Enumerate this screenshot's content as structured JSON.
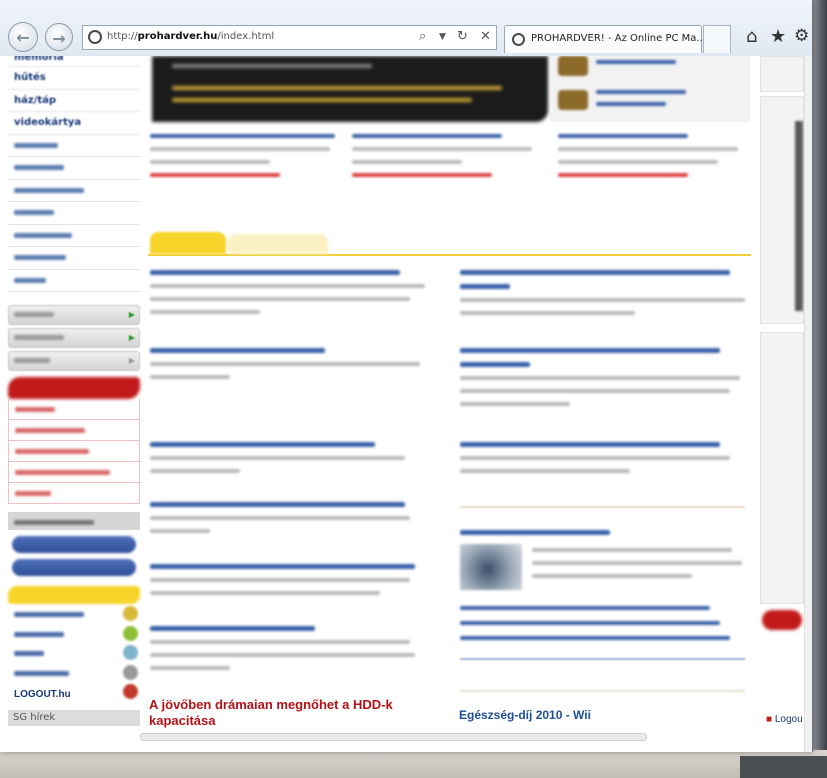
{
  "browser": {
    "url_prefix": "http://",
    "url_domain": "prohardver.hu",
    "url_path": "/index.html",
    "tab_title": "PROHARDVER! - Az Online PC Ma...",
    "icons": {
      "back": "back-arrow-icon",
      "forward": "forward-arrow-icon",
      "search": "search-icon",
      "dropdown": "chevron-down-icon",
      "refresh": "refresh-icon",
      "stop": "close-icon",
      "home": "home-icon",
      "favorites": "star-icon",
      "tools": "gear-icon"
    }
  },
  "sidebar": {
    "top_items": [
      "memória",
      "hűtés",
      "ház/táp",
      "videokártya"
    ]
  },
  "main": {
    "red_headline": "A jövőben drámaian megnőhet a HDD-k kapacitása",
    "blue_headline": "Egészség-díj 2010 - Wii"
  },
  "right": {
    "logout": "Logou"
  },
  "rss": {
    "logout_site": "LOGOUT.hu"
  },
  "sc": {
    "heading": "SG hírek"
  },
  "colors": {
    "accent_red": "#b31217",
    "link_blue": "#1a3a78",
    "tab_yellow": "#f7d42a"
  }
}
